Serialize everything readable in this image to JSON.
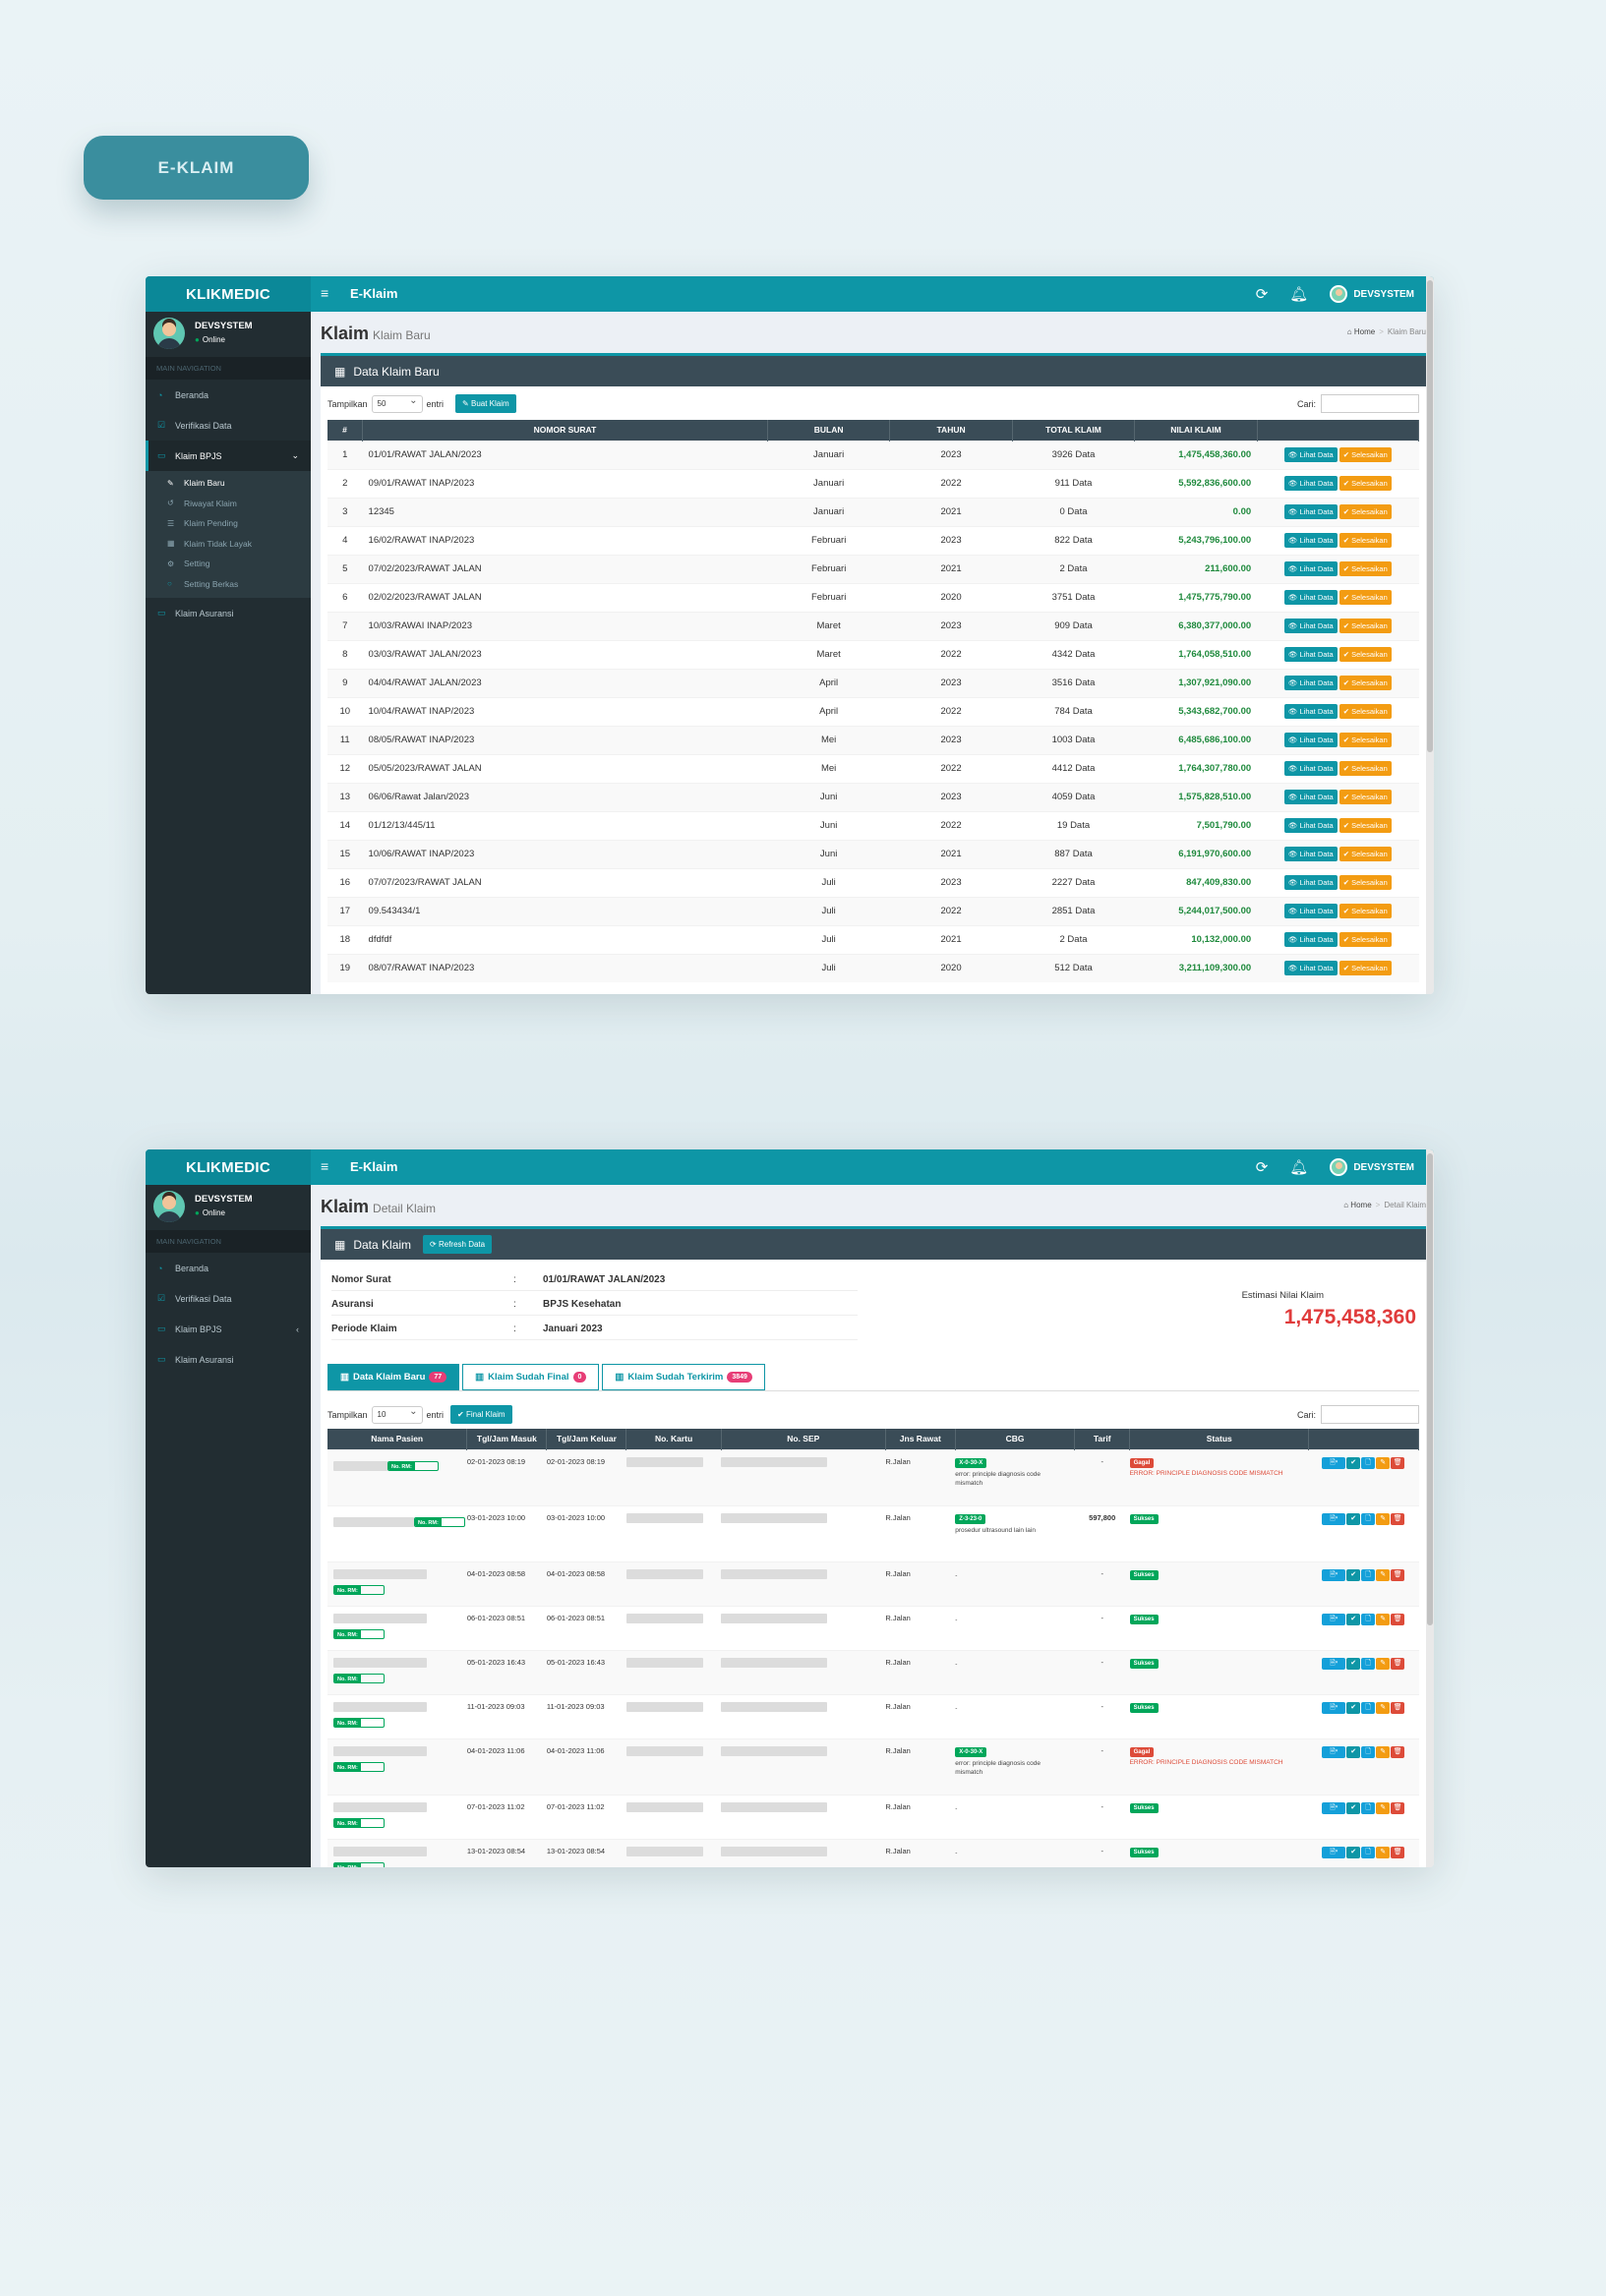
{
  "pill_label": "E-KLAIM",
  "app": {
    "brand": "KLIKMEDIC",
    "title": "E-Klaim",
    "user": "DEVSYSTEM",
    "status": "Online",
    "nav_header": "MAIN NAVIGATION",
    "nav": [
      "Beranda",
      "Verifikasi Data",
      "Klaim BPJS",
      "Klaim Asuransi"
    ],
    "submenu": [
      "Klaim Baru",
      "Riwayat Klaim",
      "Klaim Pending",
      "Klaim Tidak Layak",
      "Setting",
      "Setting Berkas"
    ],
    "home": "Home"
  },
  "screen1": {
    "page_title": "Klaim",
    "page_sub": "Klaim Baru",
    "crumb_current": "Klaim Baru",
    "box_title": "Data Klaim Baru",
    "show_label": "Tampilkan",
    "show_value": "50",
    "entries_label": "entri",
    "create_button": "Buat Klaim",
    "search_label": "Cari:",
    "columns": [
      "#",
      "NOMOR SURAT",
      "BULAN",
      "TAHUN",
      "TOTAL KLAIM",
      "NILAI KLAIM",
      ""
    ],
    "view_button": "Lihat Data",
    "finish_button": "Selesaikan",
    "rows": [
      [
        "1",
        "01/01/RAWAT JALAN/2023",
        "Januari",
        "2023",
        "3926 Data",
        "1,475,458,360.00"
      ],
      [
        "2",
        "09/01/RAWAT INAP/2023",
        "Januari",
        "2022",
        "911 Data",
        "5,592,836,600.00"
      ],
      [
        "3",
        "12345",
        "Januari",
        "2021",
        "0 Data",
        "0.00"
      ],
      [
        "4",
        "16/02/RAWAT INAP/2023",
        "Februari",
        "2023",
        "822 Data",
        "5,243,796,100.00"
      ],
      [
        "5",
        "07/02/2023/RAWAT JALAN",
        "Februari",
        "2021",
        "2 Data",
        "211,600.00"
      ],
      [
        "6",
        "02/02/2023/RAWAT JALAN",
        "Februari",
        "2020",
        "3751 Data",
        "1,475,775,790.00"
      ],
      [
        "7",
        "10/03/RAWAI INAP/2023",
        "Maret",
        "2023",
        "909 Data",
        "6,380,377,000.00"
      ],
      [
        "8",
        "03/03/RAWAT JALAN/2023",
        "Maret",
        "2022",
        "4342 Data",
        "1,764,058,510.00"
      ],
      [
        "9",
        "04/04/RAWAT JALAN/2023",
        "April",
        "2023",
        "3516 Data",
        "1,307,921,090.00"
      ],
      [
        "10",
        "10/04/RAWAT INAP/2023",
        "April",
        "2022",
        "784 Data",
        "5,343,682,700.00"
      ],
      [
        "11",
        "08/05/RAWAT INAP/2023",
        "Mei",
        "2023",
        "1003 Data",
        "6,485,686,100.00"
      ],
      [
        "12",
        "05/05/2023/RAWAT JALAN",
        "Mei",
        "2022",
        "4412 Data",
        "1,764,307,780.00"
      ],
      [
        "13",
        "06/06/Rawat Jalan/2023",
        "Juni",
        "2023",
        "4059 Data",
        "1,575,828,510.00"
      ],
      [
        "14",
        "01/12/13/445/11",
        "Juni",
        "2022",
        "19 Data",
        "7,501,790.00"
      ],
      [
        "15",
        "10/06/RAWAT INAP/2023",
        "Juni",
        "2021",
        "887 Data",
        "6,191,970,600.00"
      ],
      [
        "16",
        "07/07/2023/RAWAT JALAN",
        "Juli",
        "2023",
        "2227 Data",
        "847,409,830.00"
      ],
      [
        "17",
        "09.543434/1",
        "Juli",
        "2022",
        "2851 Data",
        "5,244,017,500.00"
      ],
      [
        "18",
        "dfdfdf",
        "Juli",
        "2021",
        "2 Data",
        "10,132,000.00"
      ],
      [
        "19",
        "08/07/RAWAT INAP/2023",
        "Juli",
        "2020",
        "512 Data",
        "3,211,109,300.00"
      ]
    ]
  },
  "screen2": {
    "page_title": "Klaim",
    "page_sub": "Detail Klaim",
    "crumb_current": "Detail Klaim",
    "box_title": "Data Klaim",
    "refresh_button": "Refresh Data",
    "info": [
      {
        "k": "Nomor Surat",
        "v": "01/01/RAWAT JALAN/2023"
      },
      {
        "k": "Asuransi",
        "v": "BPJS Kesehatan"
      },
      {
        "k": "Periode Klaim",
        "v": "Januari 2023"
      }
    ],
    "est_label": "Estimasi Nilai Klaim",
    "est_value": "1,475,458,360",
    "tabs": [
      {
        "label": "Data Klaim Baru",
        "count": "77"
      },
      {
        "label": "Klaim Sudah Final",
        "count": "0"
      },
      {
        "label": "Klaim Sudah Terkirim",
        "count": "3849"
      }
    ],
    "show_label": "Tampilkan",
    "show_value": "10",
    "entries_label": "entri",
    "final_button": "Final Klaim",
    "search_label": "Cari:",
    "columns": [
      "Nama Pasien",
      "Tgl/Jam Masuk",
      "Tgl/Jam Keluar",
      "No. Kartu",
      "No. SEP",
      "Jns Rawat",
      "CBG",
      "Tarif",
      "Status",
      ""
    ],
    "rm_label": "No. RM:",
    "rows": [
      {
        "in": "02-01-2023 08:19",
        "out": "02-01-2023 08:19",
        "jns": "R.Jalan",
        "cbg": "X-0-30-X",
        "cbg_note": "error: principle diagnosis code mismatch",
        "tarif": "-",
        "status": "Gagal",
        "err": "ERROR: PRINCIPLE DIAGNOSIS CODE MISMATCH"
      },
      {
        "in": "03-01-2023 10:00",
        "out": "03-01-2023 10:00",
        "jns": "R.Jalan",
        "cbg": "Z-3-23-0",
        "cbg_note": "prosedur ultrasound lain lain",
        "tarif": "597,800",
        "status": "Sukses",
        "err": ""
      },
      {
        "in": "04-01-2023 08:58",
        "out": "04-01-2023 08:58",
        "jns": "R.Jalan",
        "cbg": "",
        "cbg_note": "-",
        "tarif": "-",
        "status": "Sukses",
        "err": ""
      },
      {
        "in": "06-01-2023 08:51",
        "out": "06-01-2023 08:51",
        "jns": "R.Jalan",
        "cbg": "",
        "cbg_note": "-",
        "tarif": "-",
        "status": "Sukses",
        "err": ""
      },
      {
        "in": "05-01-2023 16:43",
        "out": "05-01-2023 16:43",
        "jns": "R.Jalan",
        "cbg": "",
        "cbg_note": "-",
        "tarif": "-",
        "status": "Sukses",
        "err": ""
      },
      {
        "in": "11-01-2023 09:03",
        "out": "11-01-2023 09:03",
        "jns": "R.Jalan",
        "cbg": "",
        "cbg_note": "-",
        "tarif": "-",
        "status": "Sukses",
        "err": ""
      },
      {
        "in": "04-01-2023 11:06",
        "out": "04-01-2023 11:06",
        "jns": "R.Jalan",
        "cbg": "X-0-30-X",
        "cbg_note": "error: principle diagnosis code mismatch",
        "tarif": "-",
        "status": "Gagal",
        "err": "ERROR: PRINCIPLE DIAGNOSIS CODE MISMATCH"
      },
      {
        "in": "07-01-2023 11:02",
        "out": "07-01-2023 11:02",
        "jns": "R.Jalan",
        "cbg": "",
        "cbg_note": "-",
        "tarif": "-",
        "status": "Sukses",
        "err": ""
      },
      {
        "in": "13-01-2023 08:54",
        "out": "13-01-2023 08:54",
        "jns": "R.Jalan",
        "cbg": "",
        "cbg_note": "-",
        "tarif": "-",
        "status": "Sukses",
        "err": ""
      }
    ]
  }
}
